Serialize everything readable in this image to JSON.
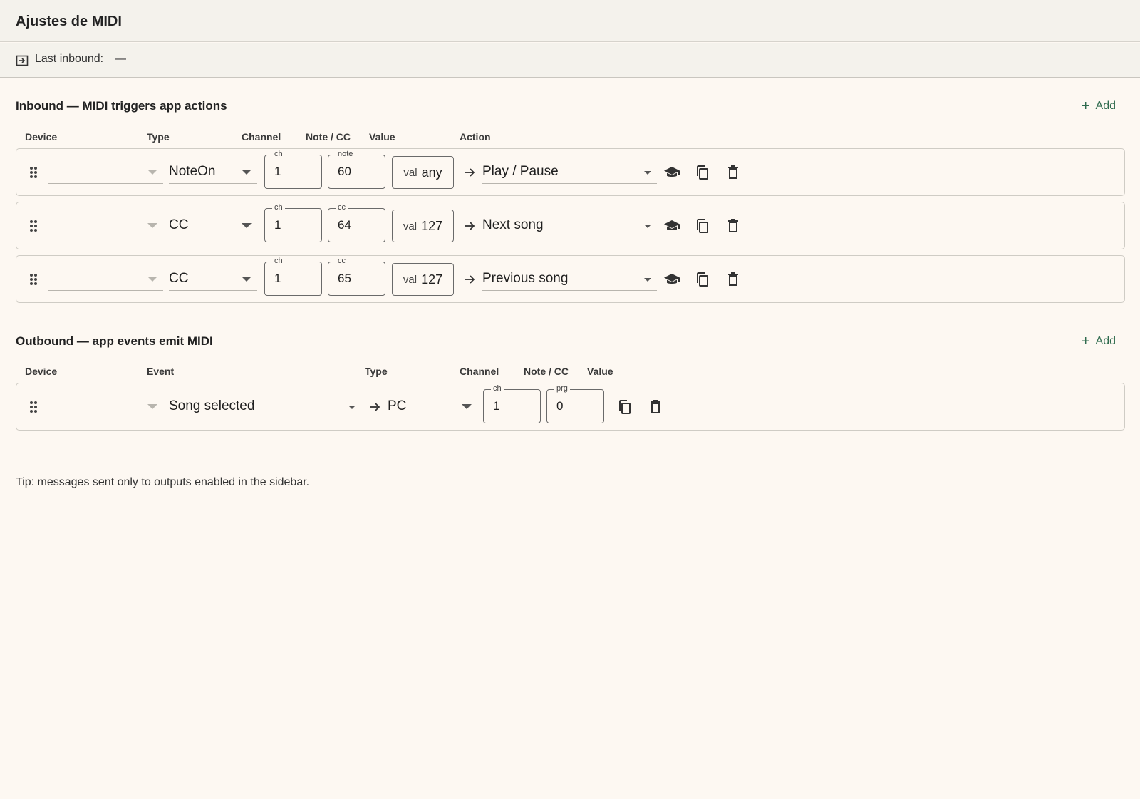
{
  "window": {
    "title": "Ajustes de MIDI"
  },
  "status": {
    "last_inbound_label": "Last inbound:",
    "last_inbound_value": "—"
  },
  "inbound": {
    "title": "Inbound — MIDI triggers app actions",
    "add_label": "Add",
    "columns": {
      "device": "Device",
      "type": "Type",
      "channel": "Channel",
      "note_cc": "Note / CC",
      "value": "Value",
      "action": "Action"
    },
    "rows": [
      {
        "device": "",
        "type": "NoteOn",
        "ch_label": "ch",
        "ch": "1",
        "num_label": "note",
        "num": "60",
        "val_label": "val",
        "val": "any",
        "action": "Play / Pause"
      },
      {
        "device": "",
        "type": "CC",
        "ch_label": "ch",
        "ch": "1",
        "num_label": "cc",
        "num": "64",
        "val_label": "val",
        "val": "127",
        "action": "Next song"
      },
      {
        "device": "",
        "type": "CC",
        "ch_label": "ch",
        "ch": "1",
        "num_label": "cc",
        "num": "65",
        "val_label": "val",
        "val": "127",
        "action": "Previous song"
      }
    ]
  },
  "outbound": {
    "title": "Outbound — app events emit MIDI",
    "add_label": "Add",
    "columns": {
      "device": "Device",
      "event": "Event",
      "type": "Type",
      "channel": "Channel",
      "note_cc": "Note / CC",
      "value": "Value"
    },
    "rows": [
      {
        "device": "",
        "event": "Song selected",
        "type": "PC",
        "ch_label": "ch",
        "ch": "1",
        "num_label": "prg",
        "num": "0"
      }
    ]
  },
  "tip": "Tip: messages sent only to outputs enabled in the sidebar.",
  "colors": {
    "accent": "#2f6b4e",
    "background": "#fdf8f2",
    "header": "#f4f2ec"
  }
}
